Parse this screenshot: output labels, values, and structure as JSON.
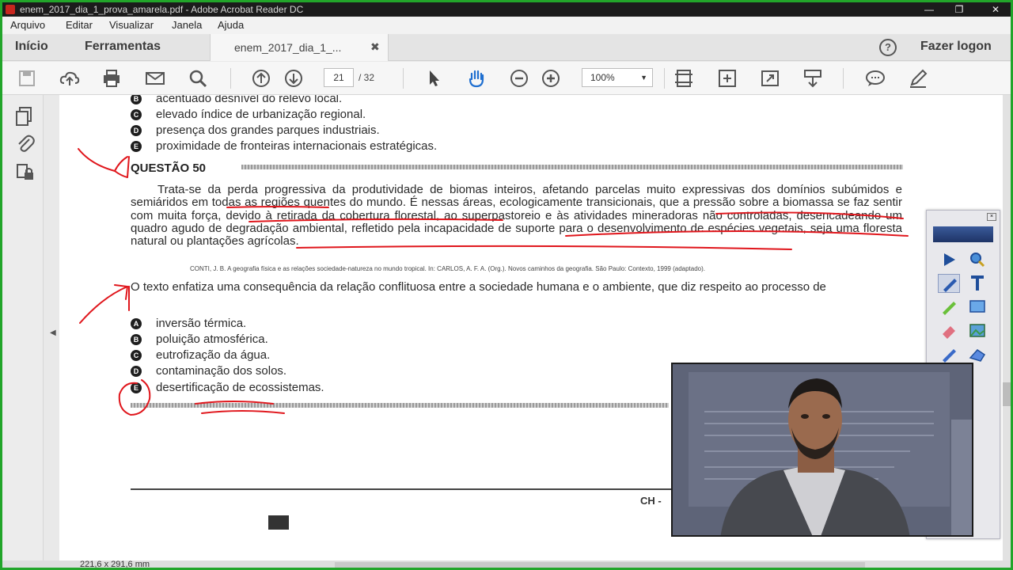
{
  "window": {
    "title": "enem_2017_dia_1_prova_amarela.pdf - Adobe Acrobat Reader DC"
  },
  "menu": [
    "Arquivo",
    "Editar",
    "Visualizar",
    "Janela",
    "Ajuda"
  ],
  "tabs": {
    "home": "Início",
    "tools": "Ferramentas",
    "document": "enem_2017_dia_1_...",
    "help": "?",
    "login": "Fazer logon"
  },
  "toolbar": {
    "current_page": "21",
    "total_pages": "/ 32",
    "zoom": "100%",
    "icons": [
      "save-icon",
      "cloud-upload-icon",
      "print-icon",
      "mail-icon",
      "search-icon",
      "page-up-icon",
      "page-down-icon",
      "select-cursor-icon",
      "hand-tool-icon",
      "zoom-out-icon",
      "zoom-in-icon",
      "fit-page-icon",
      "fit-width-icon",
      "fullscreen-icon",
      "scroll-mode-icon",
      "comment-icon",
      "sign-icon"
    ]
  },
  "document": {
    "prev_options": [
      {
        "letter": "B",
        "text": "acentuado desnível do relevo local."
      },
      {
        "letter": "C",
        "text": "elevado índice de urbanização regional."
      },
      {
        "letter": "D",
        "text": "presença dos grandes parques industriais."
      },
      {
        "letter": "E",
        "text": "proximidade de fronteiras internacionais estratégicas."
      }
    ],
    "question_title": "QUESTÃO 50",
    "paragraph": "Trata-se da perda progressiva da produtividade de biomas inteiros, afetando parcelas muito expressivas dos domínios subúmidos e semiáridos em todas as regiões quentes do mundo. É nessas áreas, ecologicamente transicionais, que a pressão sobre a biomassa se faz sentir com muita força, devido à retirada da cobertura florestal, ao superpastoreio e às atividades mineradoras não controladas, desencadeando um quadro agudo de degradação ambiental, refletido pela incapacidade de suporte para o desenvolvimento de espécies vegetais, seja uma floresta natural ou plantações agrícolas.",
    "citation": "CONTI, J. B. A geografia física e as relações sociedade-natureza no mundo tropical. In: CARLOS, A. F. A. (Org.). Novos caminhos da geografia. São Paulo: Contexto, 1999 (adaptado).",
    "stem": "O texto enfatiza uma consequência da relação conflituosa entre a sociedade humana e o ambiente, que diz respeito ao processo de",
    "options": [
      {
        "letter": "A",
        "text": "inversão térmica."
      },
      {
        "letter": "B",
        "text": "poluição atmosférica."
      },
      {
        "letter": "C",
        "text": "eutrofização da água."
      },
      {
        "letter": "D",
        "text": "contaminação dos solos."
      },
      {
        "letter": "E",
        "text": "desertificação de ecossistemas."
      }
    ],
    "footer_code": "CH -"
  },
  "status": {
    "page_size": "221,6 x 291,6 mm"
  },
  "annotation_colors": {
    "ink": "#e0161c"
  },
  "palette_tools": [
    "arrow-pointer-icon",
    "zoom-tool-icon",
    "pen-icon",
    "text-tool-icon",
    "highlighter-icon",
    "screen-icon",
    "eraser-icon",
    "image-icon",
    "marker-icon",
    "shape-icon"
  ]
}
